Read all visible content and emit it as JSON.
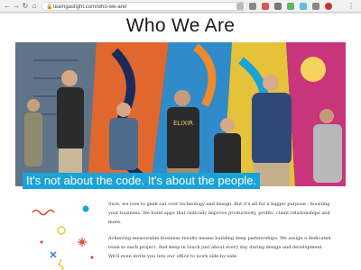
{
  "browser": {
    "url": "teamgaslight.com/who-we-are/",
    "back_icon": "back-arrow-icon",
    "forward_icon": "forward-arrow-icon",
    "reload_icon": "reload-icon",
    "home_icon": "home-icon"
  },
  "page": {
    "heading": "Who We Are",
    "tagline": "It's not about the code. It's about the people.",
    "paragraphs": [
      "Sure, we love to geek out over technology and design. But it's all for a bigger purpose - boosting your business. We build apps that radically improve productivity, profits, client relationships and more.",
      "Achieving measurable business results means building deep partnerships. We assign a dedicated team to each project. And keep in touch just about every day during design and development. We'll even invite you into our office to work side-by-side."
    ],
    "shirt_text": "ELIXIR",
    "accent_color": "#1aa3d8"
  }
}
